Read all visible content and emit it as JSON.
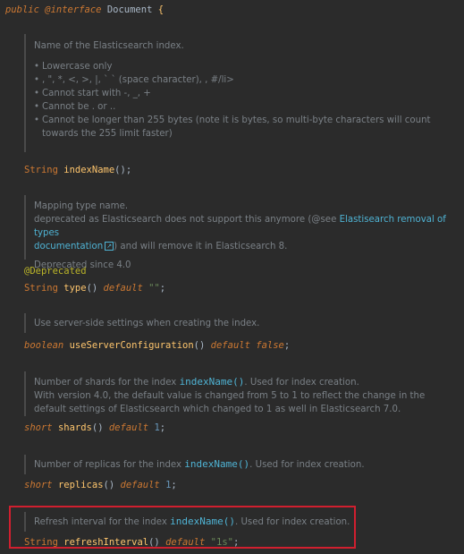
{
  "header": {
    "public": "public",
    "interface": "@interface",
    "name": "Document",
    "brace": "{"
  },
  "indexName": {
    "doc_title": "Name of the Elasticsearch index.",
    "bullets": [
      "Lowercase only",
      ", \", *, <, >, |, ` ` (space character), , #/li>",
      "Cannot start with -, _, +",
      "Cannot be . or ..",
      "Cannot be longer than 255 bytes (note it is bytes, so multi-byte characters will count towards the 255 limit faster)"
    ],
    "type": "String",
    "method": "indexName",
    "tail": "();"
  },
  "type": {
    "doc_line1": "Mapping type name.",
    "doc_line2_pre": "deprecated as Elasticsearch does not support this anymore (@see ",
    "doc_link1": "Elastisearch removal of types",
    "doc_link2": "documentation",
    "doc_line3_post": ") and will remove it in Elasticsearch 8.",
    "doc_deprecated": "Deprecated since 4.0",
    "annotation": "@Deprecated",
    "type": "String",
    "method": "type",
    "parens": "()",
    "default": "default",
    "value": "\"\"",
    "semi": ";"
  },
  "useServerConfiguration": {
    "doc": "Use server-side settings when creating the index.",
    "type": "boolean",
    "method": "useServerConfiguration",
    "parens": "()",
    "default": "default",
    "value": "false",
    "semi": ";"
  },
  "shards": {
    "doc_pre": "Number of shards for the index ",
    "doc_code": "indexName()",
    "doc_post": ". Used for index creation.",
    "doc_line2": "With version 4.0, the default value is changed from 5 to 1 to reflect the change in the default settings of Elasticsearch which changed to 1 as well in Elasticsearch 7.0.",
    "type": "short",
    "method": "shards",
    "parens": "()",
    "default": "default",
    "value": "1",
    "semi": ";"
  },
  "replicas": {
    "doc_pre": "Number of replicas for the index ",
    "doc_code": "indexName()",
    "doc_post": ". Used for index creation.",
    "type": "short",
    "method": "replicas",
    "parens": "()",
    "default": "default",
    "value": "1",
    "semi": ";"
  },
  "refreshInterval": {
    "doc_pre": "Refresh interval for the index ",
    "doc_code": "indexName()",
    "doc_post": ". Used for index creation.",
    "type": "String",
    "method": "refreshInterval",
    "parens": "()",
    "default": "default",
    "value": "\"1s\"",
    "semi": ";"
  },
  "colors": {
    "highlight_border": "#d01f2f",
    "background": "#2b2b2b"
  }
}
